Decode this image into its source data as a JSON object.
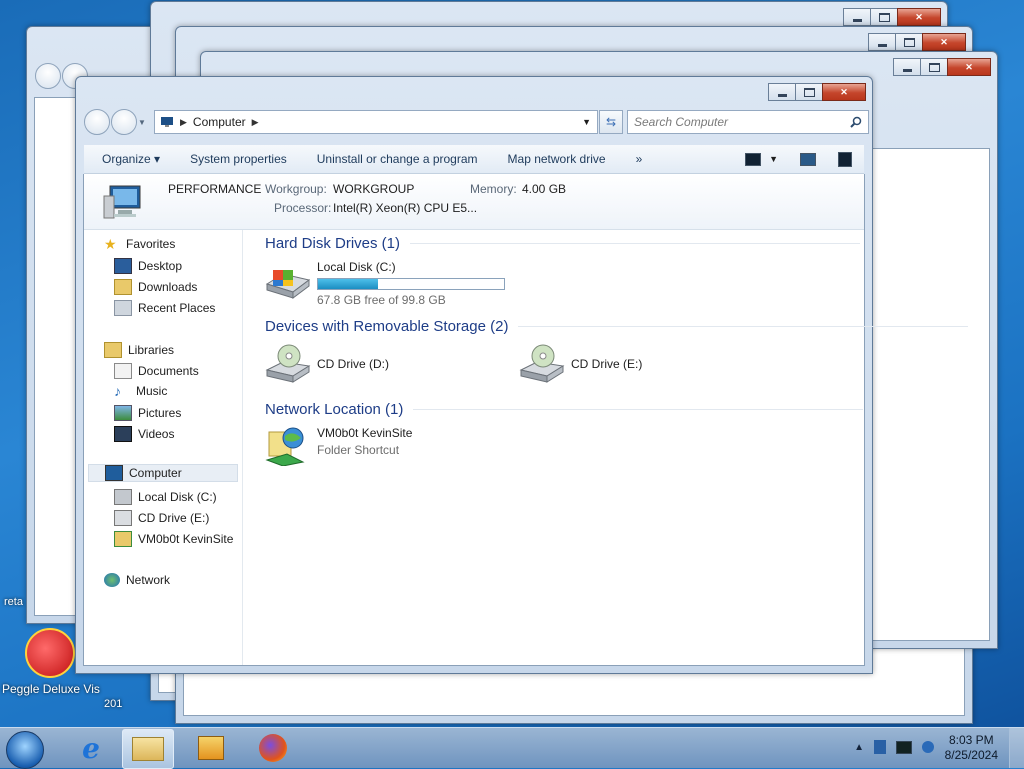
{
  "window": {
    "breadcrumb": "Computer",
    "search_placeholder": "Search Computer"
  },
  "toolbar": {
    "organize": "Organize",
    "system_properties": "System properties",
    "uninstall": "Uninstall or change a program",
    "map_drive": "Map network drive",
    "more": "»"
  },
  "details": {
    "computer_name": "PERFORMANCE",
    "workgroup_label": "Workgroup:",
    "workgroup_value": "WORKGROUP",
    "memory_label": "Memory:",
    "memory_value": "4.00 GB",
    "processor_label": "Processor:",
    "processor_value": "Intel(R) Xeon(R) CPU E5..."
  },
  "nav": {
    "favorites": "Favorites",
    "desktop": "Desktop",
    "downloads": "Downloads",
    "recent": "Recent Places",
    "libraries": "Libraries",
    "documents": "Documents",
    "music": "Music",
    "pictures": "Pictures",
    "videos": "Videos",
    "computer": "Computer",
    "local_disk": "Local Disk (C:)",
    "cd_drive_e": "CD Drive (E:)",
    "site": "VM0b0t KevinSite",
    "network": "Network"
  },
  "content": {
    "hdd_header": "Hard Disk Drives (1)",
    "local_disk_name": "Local Disk (C:)",
    "local_disk_free": "67.8 GB free of 99.8 GB",
    "local_disk_used_fraction": 0.32,
    "removable_header": "Devices with Removable Storage (2)",
    "cd_d": "CD Drive (D:)",
    "cd_e": "CD Drive (E:)",
    "netloc_header": "Network Location (1)",
    "site_name": "VM0b0t KevinSite",
    "site_type": "Folder Shortcut"
  },
  "desktop": {
    "peggle": "Peggle Deluxe",
    "partial_vis": "Vis",
    "partial_reta": "reta",
    "partial_201": "201"
  },
  "taskbar": {
    "time": "8:03 PM",
    "date": "8/25/2024"
  }
}
